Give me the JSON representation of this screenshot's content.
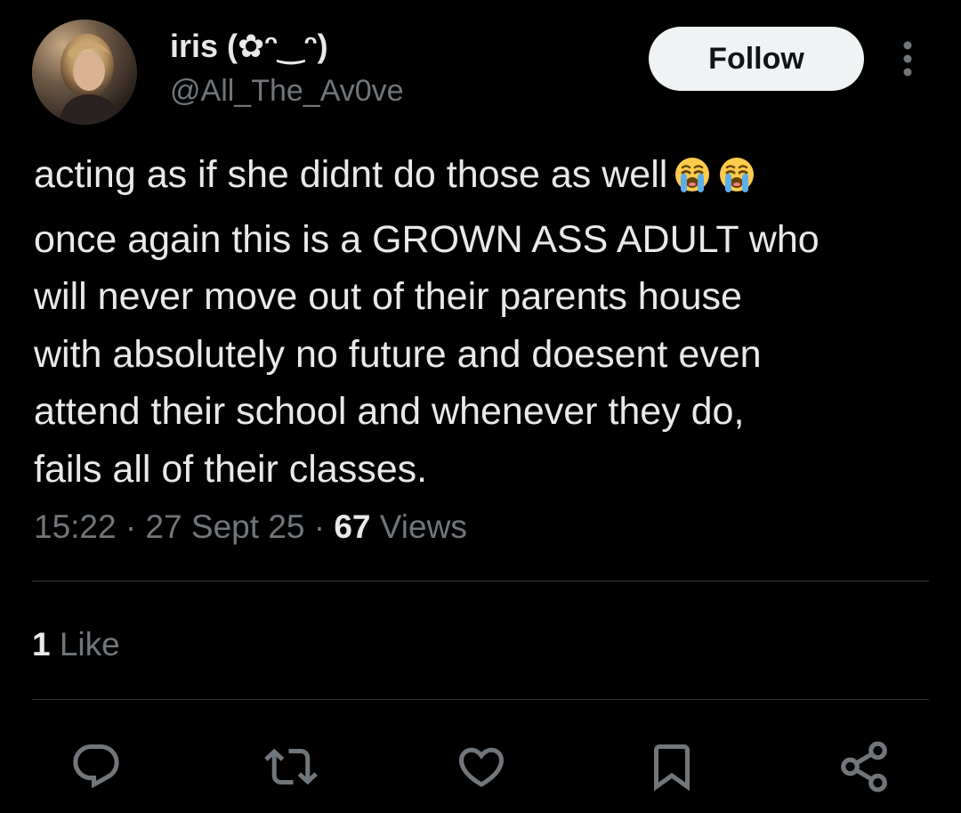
{
  "author": {
    "display_name": "iris (✿ᵔ‿ᵔ)",
    "handle": "@All_The_Av0ve",
    "avatar_icon": "profile-photo"
  },
  "header": {
    "follow_label": "Follow",
    "more_icon": "more-vertical-icon"
  },
  "tweet": {
    "line1": "acting as if she didnt do those as well",
    "line1_emojis": [
      "loudly-crying-face",
      "loudly-crying-face"
    ],
    "lines_rest": [
      "once again this is a GROWN ASS ADULT who",
      "will never move out of their parents house",
      "with absolutely no future and doesent even",
      "attend their school and whenever they do,",
      "fails all of their classes."
    ]
  },
  "meta": {
    "time": "15:22",
    "separator": "·",
    "date": "27 Sept 25",
    "views_count": "67",
    "views_label": "Views"
  },
  "engagement": {
    "likes_count": "1",
    "likes_label": "Like"
  },
  "actions": [
    {
      "name": "reply",
      "icon": "reply-icon"
    },
    {
      "name": "retweet",
      "icon": "retweet-icon"
    },
    {
      "name": "like",
      "icon": "heart-icon"
    },
    {
      "name": "bookmark",
      "icon": "bookmark-icon"
    },
    {
      "name": "share",
      "icon": "share-icon"
    }
  ],
  "colors": {
    "background": "#000000",
    "text_primary": "#e7e9ea",
    "text_secondary": "#71767b",
    "divider": "#2f3336",
    "follow_bg": "#eff3f4",
    "follow_text": "#0f1419"
  }
}
